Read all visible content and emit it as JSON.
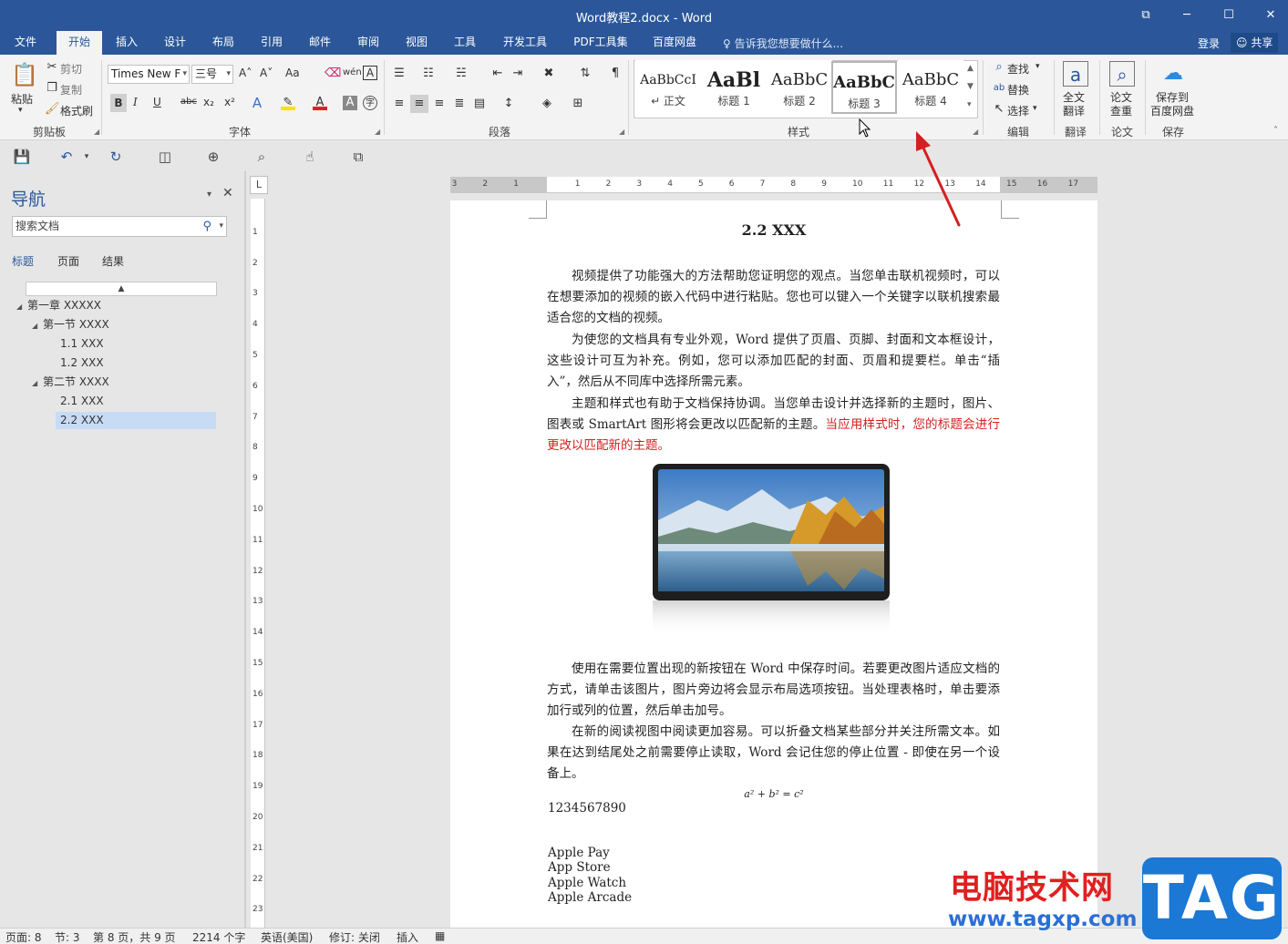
{
  "window": {
    "title": "Word教程2.docx - Word",
    "restore_glyph": "⧉",
    "minimize_glyph": "─",
    "maximize_glyph": "☐",
    "close_glyph": "✕"
  },
  "tabs": [
    "文件",
    "开始",
    "插入",
    "设计",
    "布局",
    "引用",
    "邮件",
    "审阅",
    "视图",
    "工具",
    "开发工具",
    "PDF工具集",
    "百度网盘"
  ],
  "tell_me": "告诉我您想要做什么...",
  "account": {
    "login": "登录",
    "share": "共享"
  },
  "ribbon": {
    "clipboard": {
      "paste": "粘贴",
      "cut": "剪切",
      "copy": "复制",
      "format_painter": "格式刷",
      "label": "剪贴板"
    },
    "font": {
      "name": "Times New F",
      "size": "三号",
      "label": "字体",
      "bold": "B",
      "italic": "I",
      "underline": "U",
      "strike": "abc",
      "sub": "x₂",
      "sup": "x²",
      "grow": "A˄",
      "shrink": "A˅",
      "case": "Aa",
      "clear": "A",
      "color_a": "A"
    },
    "paragraph": {
      "label": "段落"
    },
    "styles": {
      "label": "样式",
      "items": [
        {
          "preview": "AaBbCcI",
          "name": "↵ 正文"
        },
        {
          "preview": "AaBl",
          "name": "标题 1"
        },
        {
          "preview": "AaBbC",
          "name": "标题 2"
        },
        {
          "preview": "AaBbC",
          "name": "标题 3"
        },
        {
          "preview": "AaBbC",
          "name": "标题 4"
        }
      ]
    },
    "editing": {
      "find": "查找",
      "replace": "替换",
      "select": "选择",
      "label": "编辑"
    },
    "translate": {
      "button": "全文\n翻译",
      "label": "翻译"
    },
    "paper": {
      "button": "论文\n查重",
      "label": "论文"
    },
    "save": {
      "button": "保存到\n百度网盘",
      "label": "保存"
    }
  },
  "nav": {
    "title": "导航",
    "search_placeholder": "搜索文档",
    "tabs": [
      "标题",
      "页面",
      "结果"
    ],
    "tree": [
      {
        "label": "第一章 XXXXX",
        "level": 0
      },
      {
        "label": "第一节 XXXX",
        "level": 1
      },
      {
        "label": "1.1 XXX",
        "level": 2
      },
      {
        "label": "1.2 XXX",
        "level": 2
      },
      {
        "label": "第二节 XXXX",
        "level": 1
      },
      {
        "label": "2.1 XXX",
        "level": 2
      },
      {
        "label": "2.2 XXX",
        "level": 2,
        "selected": true
      }
    ]
  },
  "ruler_corner": "L",
  "document": {
    "heading": "2.2 XXX",
    "p1": "视频提供了功能强大的方法帮助您证明您的观点。当您单击联机视频时，可以在想要添加的视频的嵌入代码中进行粘贴。您也可以键入一个关键字以联机搜索最适合您的文档的视频。",
    "p2": "为使您的文档具有专业外观，Word 提供了页眉、页脚、封面和文本框设计，这些设计可互为补充。例如，您可以添加匹配的封面、页眉和提要栏。单击“插入”，然后从不同库中选择所需元素。",
    "p3_black": "主题和样式也有助于文档保持协调。当您单击设计并选择新的主题时，图片、图表或 SmartArt 图形将会更改以匹配新的主题。",
    "p3_red": "当应用样式时，您的标题会进行更改以匹配新的主题。",
    "p4": "使用在需要位置出现的新按钮在 Word 中保存时间。若要更改图片适应文档的方式，请单击该图片，图片旁边将会显示布局选项按钮。当处理表格时，单击要添加行或列的位置，然后单击加号。",
    "p5": "在新的阅读视图中阅读更加容易。可以折叠文档某些部分并关注所需文本。如果在达到结尾处之前需要停止读取，Word 会记住您的停止位置 - 即使在另一个设备上。",
    "formula": "a² + b² = c²",
    "number_line": "1234567890",
    "list": [
      "Apple Pay",
      "App Store",
      "Apple Watch",
      "Apple Arcade"
    ]
  },
  "status": {
    "page": "页面: 8",
    "section": "节: 3",
    "page_of": "第 8 页，共 9 页",
    "words": "2214 个字",
    "language": "英语(美国)",
    "track": "修订: 关闭",
    "mode": "插入"
  },
  "watermark": {
    "text": "电脑技术网",
    "url": "www.tagxp.com",
    "tag": "TAG"
  },
  "colors": {
    "brand": "#2b579a",
    "red_text": "#d42020",
    "arrow": "#d42020"
  }
}
